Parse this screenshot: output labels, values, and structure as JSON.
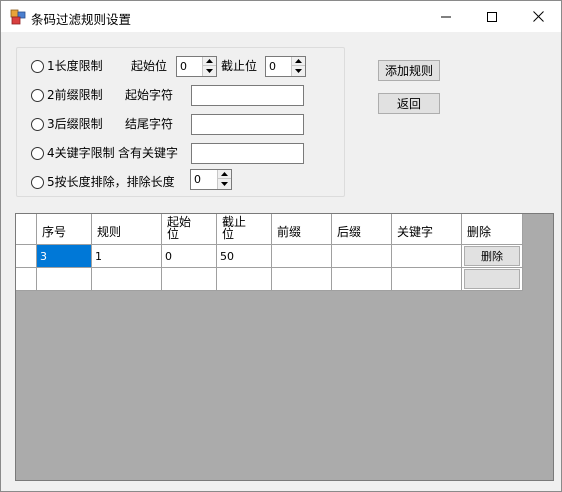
{
  "window": {
    "title": "条码过滤规则设置"
  },
  "filters": {
    "length": {
      "label": "1长度限制",
      "start_label": "起始位",
      "start_value": "0",
      "end_label": "截止位",
      "end_value": "0",
      "selected": false
    },
    "prefix": {
      "label": "2前缀限制",
      "field_label": "起始字符",
      "value": "",
      "selected": false
    },
    "suffix": {
      "label": "3后缀限制",
      "field_label": "结尾字符",
      "value": "",
      "selected": false
    },
    "keyword": {
      "label": "4关键字限制",
      "field_label": "含有关键字",
      "value": "",
      "selected": false
    },
    "exclude": {
      "label": "5按长度排除，排除长度",
      "value": "0",
      "selected": false
    }
  },
  "actions": {
    "add_label": "添加规则",
    "back_label": "返回"
  },
  "grid": {
    "headers": {
      "seq": "序号",
      "rule": "规则",
      "start_line1": "起始",
      "start_line2": "位",
      "end_line1": "截止",
      "end_line2": "位",
      "prefix": "前缀",
      "suffix": "后缀",
      "keyword": "关键字",
      "delete": "删除"
    },
    "rows": [
      {
        "seq": "3",
        "rule": "1",
        "start": "0",
        "end": "50",
        "prefix": "",
        "suffix": "",
        "keyword": "",
        "delete_label": "删除"
      }
    ]
  }
}
